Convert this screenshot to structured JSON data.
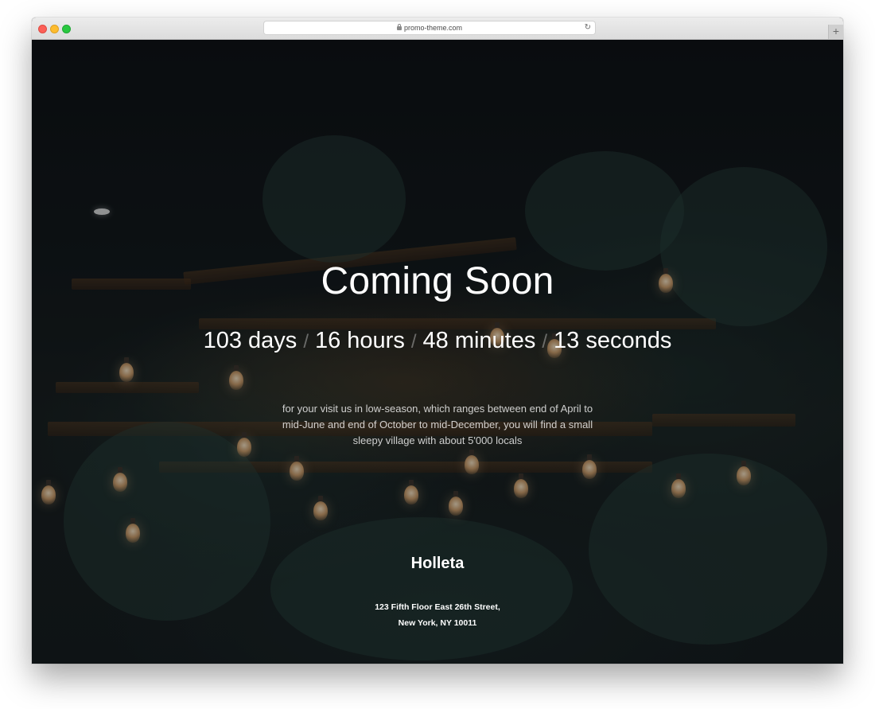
{
  "browser": {
    "url": "promo-theme.com",
    "newtab_label": "+",
    "reload_icon": "reload-icon",
    "lock_icon": "lock-icon"
  },
  "page": {
    "title": "Coming Soon",
    "countdown": {
      "days": "103 days",
      "hours": "16 hours",
      "minutes": "48 minutes",
      "seconds": "13 seconds",
      "separator": "/"
    },
    "description": "for your visit us in low-season, which ranges between end of April to mid-June and end of October to mid-December, you will find a small sleepy village with about 5'000 locals",
    "brand": "Holleta",
    "address": {
      "line1": "123 Fifth Floor East 26th Street,",
      "line2": "New York, NY 10011"
    }
  },
  "colors": {
    "close": "#fc5f57",
    "minimize": "#fdbc2e",
    "maximize": "#28c840",
    "text": "#ffffff"
  }
}
